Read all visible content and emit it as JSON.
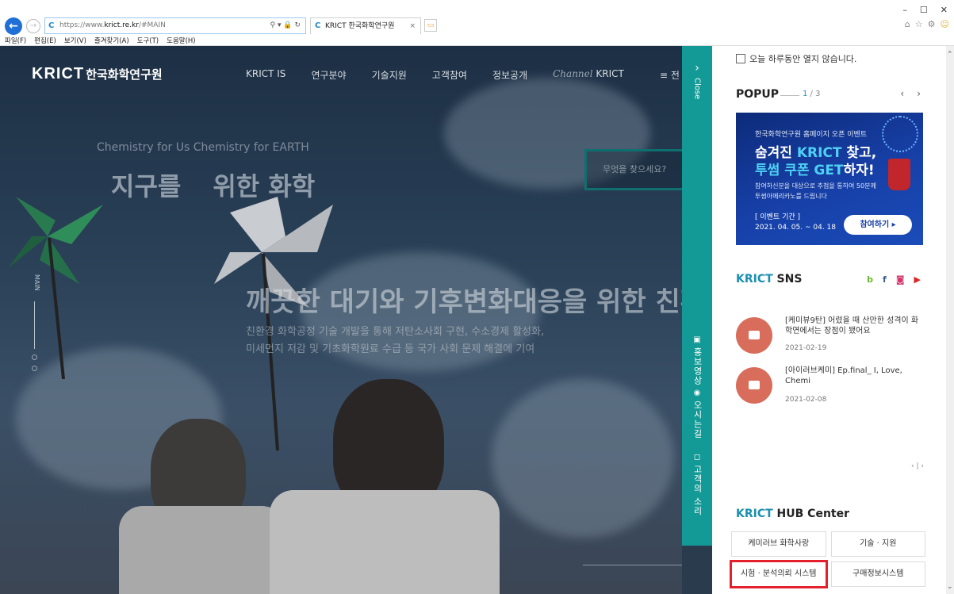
{
  "browser": {
    "url_prefix": "https://www.",
    "url_host": "krict.re.kr",
    "url_suffix": "/#MAIN",
    "addr_controls": "⚲ ▾ 🔒 ↻",
    "tab_title": "KRICT 한국화학연구원",
    "menu": [
      "파일(F)",
      "편집(E)",
      "보기(V)",
      "즐겨찾기(A)",
      "도구(T)",
      "도움말(H)"
    ]
  },
  "site": {
    "logo_en": "KRICT",
    "logo_ko": "한국화학연구원",
    "nav": [
      "KRICT IS",
      "연구분야",
      "기술지원",
      "고객참여",
      "정보공개"
    ],
    "channel_script": "Channel",
    "channel_word": "KRICT",
    "menu_label": "≡ 전",
    "slogan_en": "Chemistry for Us Chemistry for EARTH",
    "slogan_ko_a": "지구를",
    "slogan_ko_b": "위한 화학",
    "search_placeholder": "무엇을 찾으세요?",
    "main_label": "MAIN",
    "headline": "깨끗한 대기와 기후변화대응을 위한 친환",
    "sub1": "친환경 화학공정 기술 개발을 통해 저탄소사회 구현, 수소경제 활성화,",
    "sub2": "미세먼지 저감 및 기초화학원료 수급 등 국가 사회 문제 해결에 기여"
  },
  "sidebar": {
    "close": "Close",
    "links": [
      {
        "icon": "▣",
        "label": "홍보영상"
      },
      {
        "icon": "◉",
        "label": "오시는길"
      },
      {
        "icon": "◻",
        "label": "고객의 소리"
      }
    ]
  },
  "panel": {
    "no_today": "오늘 하루동안 열지 않습니다.",
    "popup_title": "POPUP",
    "popup_cur": "1",
    "popup_total": " / 3",
    "banner": {
      "l1": "한국화학연구원 홈페이지 오픈 이벤트",
      "l2a": "숨겨진 ",
      "l2b": "KRICT",
      "l2c": " 찾고,",
      "l3a": "투썸 쿠폰 GET",
      "l3b": "하자!",
      "l4": "참여하신분을 대상으로 추첨을 통하여 50분께 투썸아메리카노를 드립니다",
      "l5a": "[ 이벤트 기간 ]",
      "l5b": "2021. 04. 05. ~ 04. 18",
      "btn": "참여하기 ▸"
    },
    "sns_title_a": "KRICT",
    "sns_title_b": " SNS",
    "sns_items": [
      {
        "title": "[케미뷰9탄] 어렸을 때 산만한 성격이 화학연에서는 장점이 됐어요",
        "date": "2021-02-19"
      },
      {
        "title": "[아이러브케미] Ep.final_ I, Love, Chemi",
        "date": "2021-02-08"
      }
    ],
    "sns_pager": "‹ | ›",
    "hub_title_a": "KRICT",
    "hub_title_b": " HUB Center",
    "hub": [
      "케미러브 화학사랑",
      "기술 · 지원",
      "시험 · 분석의뢰 시스템",
      "구매정보시스템"
    ]
  },
  "colors": {
    "teal": "#149a96",
    "accent": "#1a8fb0",
    "highlight": "#e3212c"
  }
}
